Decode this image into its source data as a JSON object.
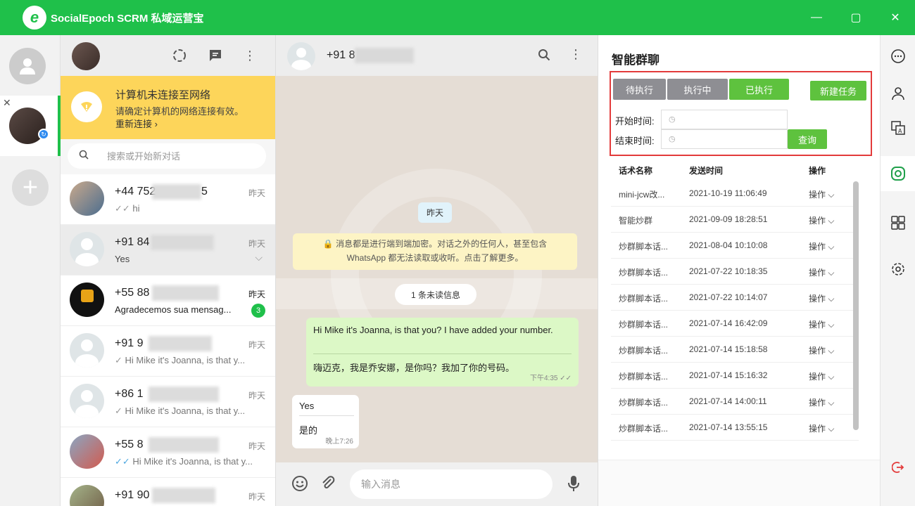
{
  "window": {
    "title": "SocialEpoch SCRM 私域运营宝",
    "logo_letter": "e",
    "controls": [
      "—",
      "▢",
      "✕"
    ]
  },
  "colors": {
    "brand": "#1fc04a",
    "banner": "#fdd55a",
    "highlight": "#e33b3b"
  },
  "chatlist": {
    "banner": {
      "title": "计算机未连接至网络",
      "desc": "请确定计算机的网络连接有效。",
      "link": "重新连接 ›"
    },
    "search_placeholder": "搜索或开始新对话",
    "items": [
      {
        "name": "+44 752",
        "tail": "5",
        "time": "昨天",
        "ticks": "✓✓",
        "preview": "hi"
      },
      {
        "name": "+91 84",
        "time": "昨天",
        "preview": "Yes"
      },
      {
        "name": "+55 88",
        "time": "昨天",
        "preview": "Agradecemos sua mensag...",
        "badge": "3"
      },
      {
        "name": "+91 9",
        "time": "昨天",
        "ticks": "✓",
        "preview": "Hi Mike it's Joanna, is that y..."
      },
      {
        "name": "+86 1",
        "time": "昨天",
        "ticks": "✓",
        "preview": "Hi Mike it's Joanna, is that y..."
      },
      {
        "name": "+55 8",
        "time": "昨天",
        "ticks": "✓✓",
        "preview": "Hi Mike it's Joanna, is that y..."
      },
      {
        "name": "+91 90",
        "time": "昨天",
        "preview": ""
      }
    ]
  },
  "conversation": {
    "title": "+91 8",
    "date_chip": "昨天",
    "system_note_1": "🔒 消息都是进行端到端加密。对话之外的任何人，甚至包含",
    "system_note_2": "WhatsApp 都无法读取或收听。点击了解更多。",
    "unread": "1 条未读信息",
    "outgoing": {
      "line1": "Hi Mike it's Joanna, is that you? I have added your number.",
      "line2": "嗨迈克，我是乔安娜，是你吗？我加了你的号码。",
      "time": "下午4:35 ✓✓"
    },
    "incoming": {
      "line1": "Yes",
      "line2": "是的",
      "time": "晚上7:26"
    },
    "compose_placeholder": "输入消息"
  },
  "panel": {
    "title": "智能群聊",
    "buttons": {
      "pending": "待执行",
      "running": "执行中",
      "done": "已执行",
      "new_task": "新建任务",
      "query": "查询"
    },
    "start_label": "开始时间:",
    "end_label": "结束时间:",
    "columns": {
      "name": "话术名称",
      "time": "发送时间",
      "action": "操作"
    },
    "rows": [
      {
        "name": "mini-jcw改...",
        "time": "2021-10-19 11:06:49",
        "action": "操作 ⌵"
      },
      {
        "name": "智能炒群",
        "time": "2021-09-09 18:28:51",
        "action": "操作 ⌵"
      },
      {
        "name": "炒群脚本话...",
        "time": "2021-08-04 10:10:08",
        "action": "操作 ⌵"
      },
      {
        "name": "炒群脚本话...",
        "time": "2021-07-22 10:18:35",
        "action": "操作 ⌵"
      },
      {
        "name": "炒群脚本话...",
        "time": "2021-07-22 10:14:07",
        "action": "操作 ⌵"
      },
      {
        "name": "炒群脚本话...",
        "time": "2021-07-14 16:42:09",
        "action": "操作 ⌵"
      },
      {
        "name": "炒群脚本话...",
        "time": "2021-07-14 15:18:58",
        "action": "操作 ⌵"
      },
      {
        "name": "炒群脚本话...",
        "time": "2021-07-14 15:16:32",
        "action": "操作 ⌵"
      },
      {
        "name": "炒群脚本话...",
        "time": "2021-07-14 14:00:11",
        "action": "操作 ⌵"
      },
      {
        "name": "炒群脚本话...",
        "time": "2021-07-14 13:55:15",
        "action": "操作 ⌵"
      }
    ]
  },
  "toolrail": [
    "chat-bubble-icon",
    "user-icon",
    "translate-icon",
    "smart-group-icon",
    "apps-grid-icon",
    "gear-icon",
    "logout-icon"
  ]
}
